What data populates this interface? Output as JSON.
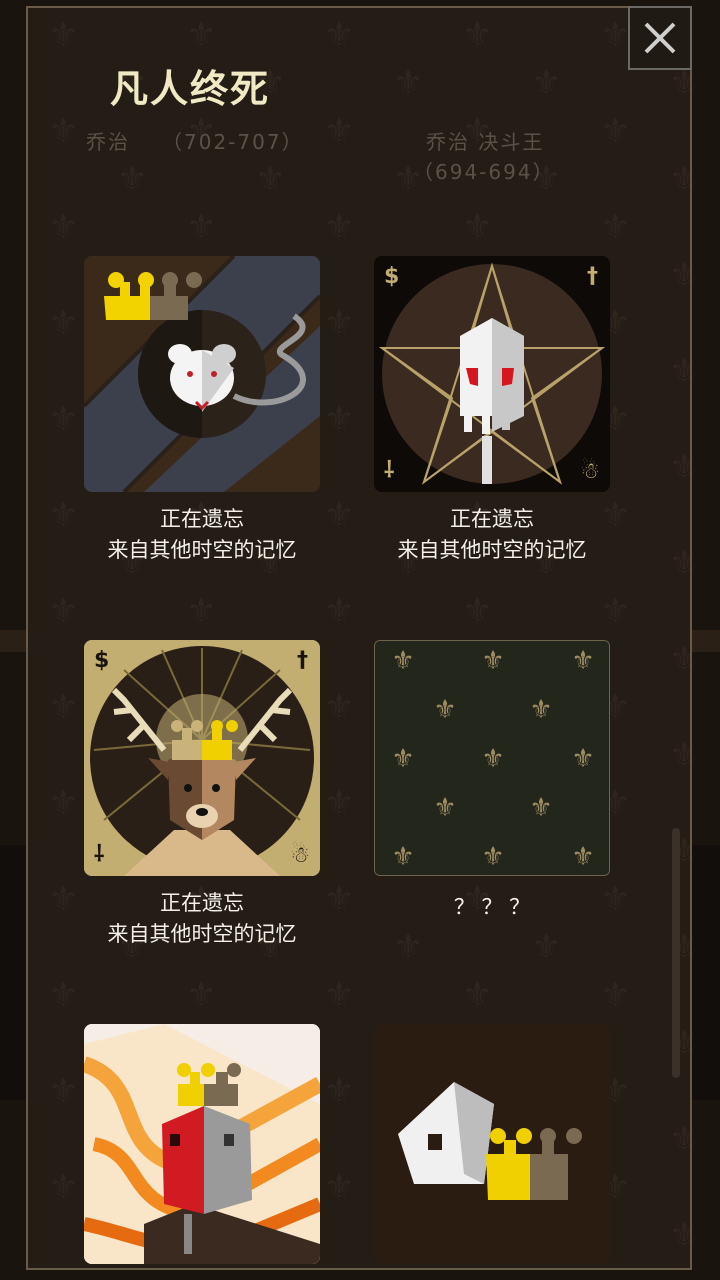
{
  "dialog": {
    "title": "凡人终死",
    "close_icon": "close-icon"
  },
  "previous_row": {
    "left_name": "乔治",
    "left_years": "（702-707）",
    "right_name": "乔治  决斗王",
    "right_years": "（694-694）"
  },
  "cards": [
    {
      "icon": "rat-king-icon",
      "line1": "正在遗忘",
      "line2": "来自其他时空的记忆"
    },
    {
      "icon": "skull-pentagram-icon",
      "line1": "正在遗忘",
      "line2": "来自其他时空的记忆"
    },
    {
      "icon": "stag-king-icon",
      "line1": "正在遗忘",
      "line2": "来自其他时空的记忆"
    },
    {
      "icon": "locked-card-icon",
      "line1": "？ ？ ？",
      "line2": ""
    },
    {
      "icon": "burning-king-icon",
      "line1": "",
      "line2": ""
    },
    {
      "icon": "fallen-crown-icon",
      "line1": "",
      "line2": ""
    }
  ],
  "corner_symbols": {
    "money": "$",
    "church": "†",
    "army": "⸸",
    "people": "☃"
  },
  "colors": {
    "background": "#241d16",
    "frame": "#6b5a46",
    "title": "#f1e9c3",
    "gold": "#c3ae72",
    "crown_yellow": "#f0d000"
  }
}
